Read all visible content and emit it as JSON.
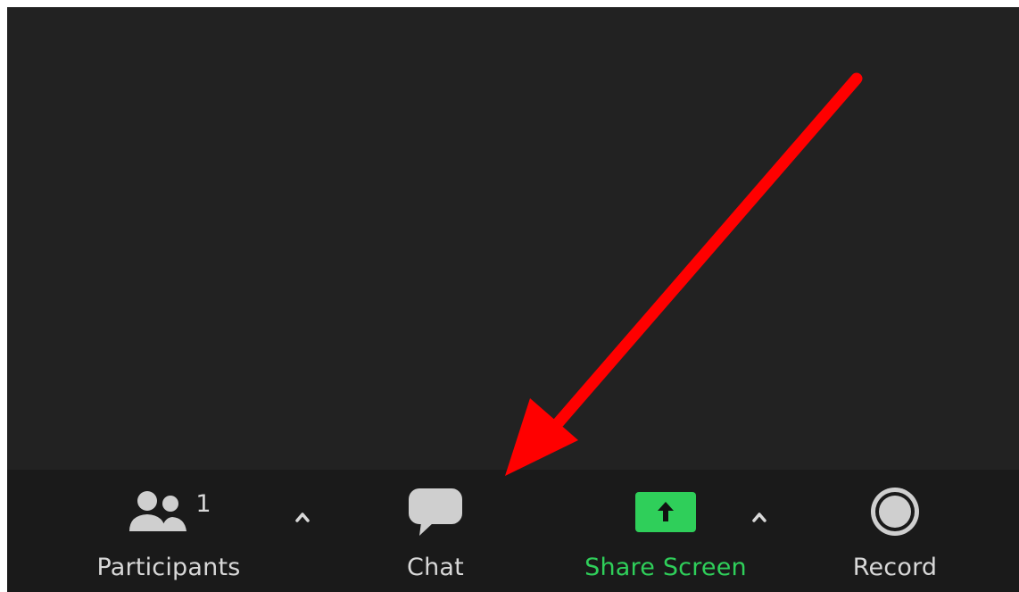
{
  "toolbar": {
    "participants": {
      "label": "Participants",
      "count": "1"
    },
    "chat": {
      "label": "Chat"
    },
    "share_screen": {
      "label": "Share Screen"
    },
    "record": {
      "label": "Record"
    }
  },
  "colors": {
    "stage_bg": "#222222",
    "toolbar_bg": "#1a1a1a",
    "label_gray": "#d8d8d8",
    "share_green": "#2fcf5a",
    "annotation_red": "#ff0000"
  },
  "icons": [
    "participants-icon",
    "caret-up-icon",
    "chat-bubble-icon",
    "share-screen-icon",
    "record-icon"
  ]
}
